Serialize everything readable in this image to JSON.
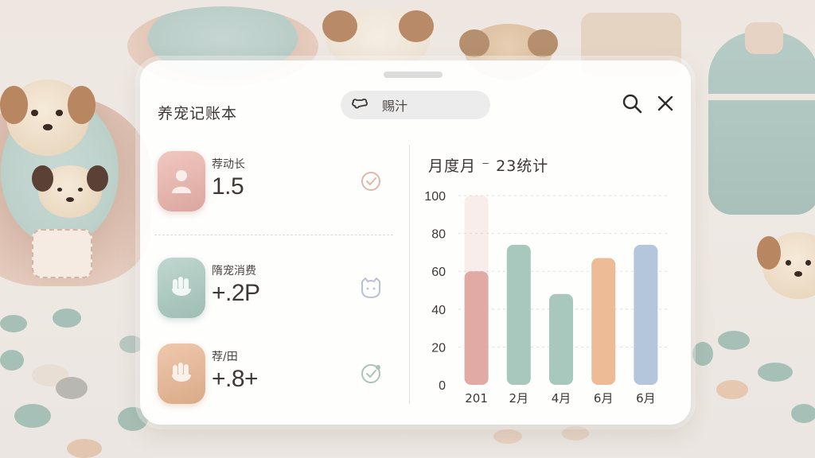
{
  "app": {
    "title": "养宠记账本",
    "search": {
      "text": "赐汁",
      "icon": "bone-icon"
    }
  },
  "toolbar": {
    "search_icon": "search-icon",
    "close_icon": "close-icon"
  },
  "cards": [
    {
      "label": "荐动长",
      "value": "1.5",
      "icon": "user-icon",
      "status_icon": "check-circle-icon",
      "color": "#e5b5ad"
    },
    {
      "label": "隋宠消费",
      "value": "+.2P",
      "icon": "paw-icon",
      "status_icon": "cat-face-icon",
      "color": "#a9c6bd"
    },
    {
      "label": "荐/田",
      "value": "+.8+",
      "icon": "paw-icon",
      "status_icon": "check-circle-icon",
      "color": "#e0b493"
    }
  ],
  "chart_title": "月度月 ⁻ 23统计",
  "chart_data": {
    "type": "bar",
    "categories": [
      "201",
      "2月",
      "4月",
      "6月",
      "6月"
    ],
    "values": [
      60,
      74,
      48,
      67,
      74
    ],
    "ghost_values": [
      100,
      null,
      null,
      null,
      null
    ],
    "yticks": [
      0,
      20,
      40,
      60,
      80,
      100
    ],
    "ylim": [
      0,
      100
    ],
    "grid": true,
    "colors": [
      "#e1aaa5",
      "#a8c7bd",
      "#a8c7bd",
      "#edbc96",
      "#b4c6dc"
    ]
  }
}
